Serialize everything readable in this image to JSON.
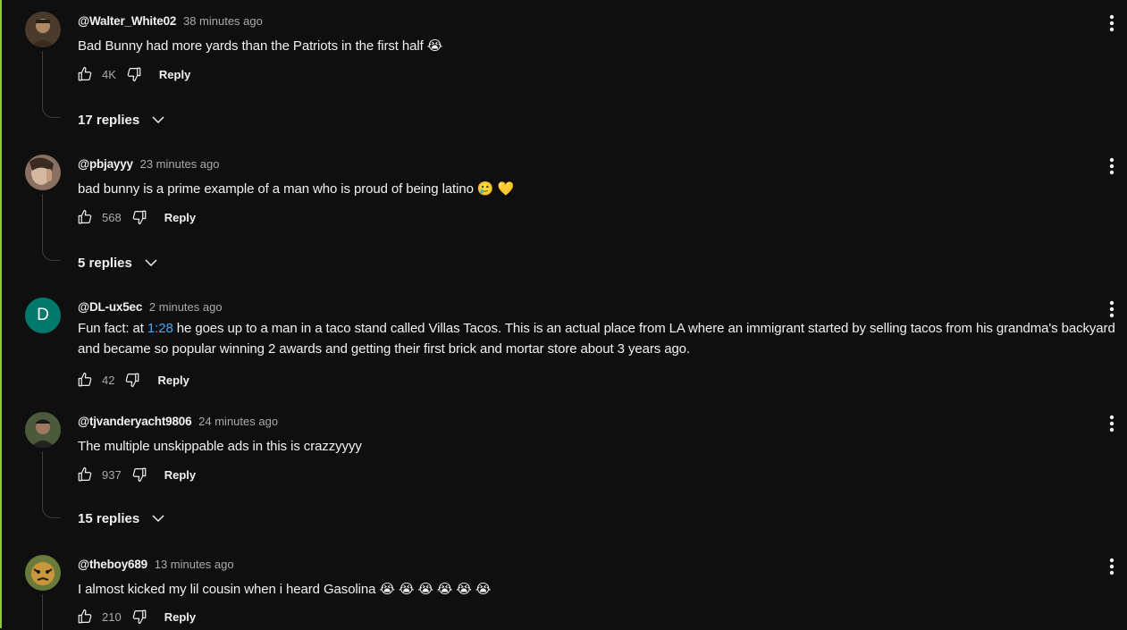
{
  "comments": [
    {
      "author": "@Walter_White02",
      "time": "38 minutes ago",
      "text": "Bad Bunny had more yards than the Patriots in the first half 😭",
      "likes": "4K",
      "reply_label": "Reply",
      "replies_label": "17 replies"
    },
    {
      "author": "@pbjayyy",
      "time": "23 minutes ago",
      "text": "bad bunny is a prime example of a man who is proud of being latino 🥲 💛",
      "likes": "568",
      "reply_label": "Reply",
      "replies_label": "5 replies"
    },
    {
      "author": "@DL-ux5ec",
      "avatar_letter": "D",
      "time": "2 minutes ago",
      "text_before": "Fun fact: at ",
      "text_link": "1:28",
      "text_after": " he goes up to a man in a taco stand called Villas Tacos. This is an actual place from LA where an immigrant started by selling tacos from his grandma's backyard and became so popular winning 2 awards and getting their first brick and mortar store about 3 years ago.",
      "likes": "42",
      "reply_label": "Reply"
    },
    {
      "author": "@tjvanderyacht9806",
      "time": "24 minutes ago",
      "text": "The multiple unskippable ads in this is crazzyyyy",
      "likes": "937",
      "reply_label": "Reply",
      "replies_label": "15 replies"
    },
    {
      "author": "@theboy689",
      "time": "13 minutes ago",
      "text": "I almost kicked my lil cousin when i heard Gasolina 😭 😭 😭 😭 😭 😭",
      "likes": "210",
      "reply_label": "Reply"
    }
  ],
  "colors": {
    "background": "#0f0f0f",
    "accent_bar": "#8ec63f",
    "link": "#3ea6ff",
    "secondary_text": "#aaaaaa",
    "avatar_letter_bg": "#00796b"
  }
}
